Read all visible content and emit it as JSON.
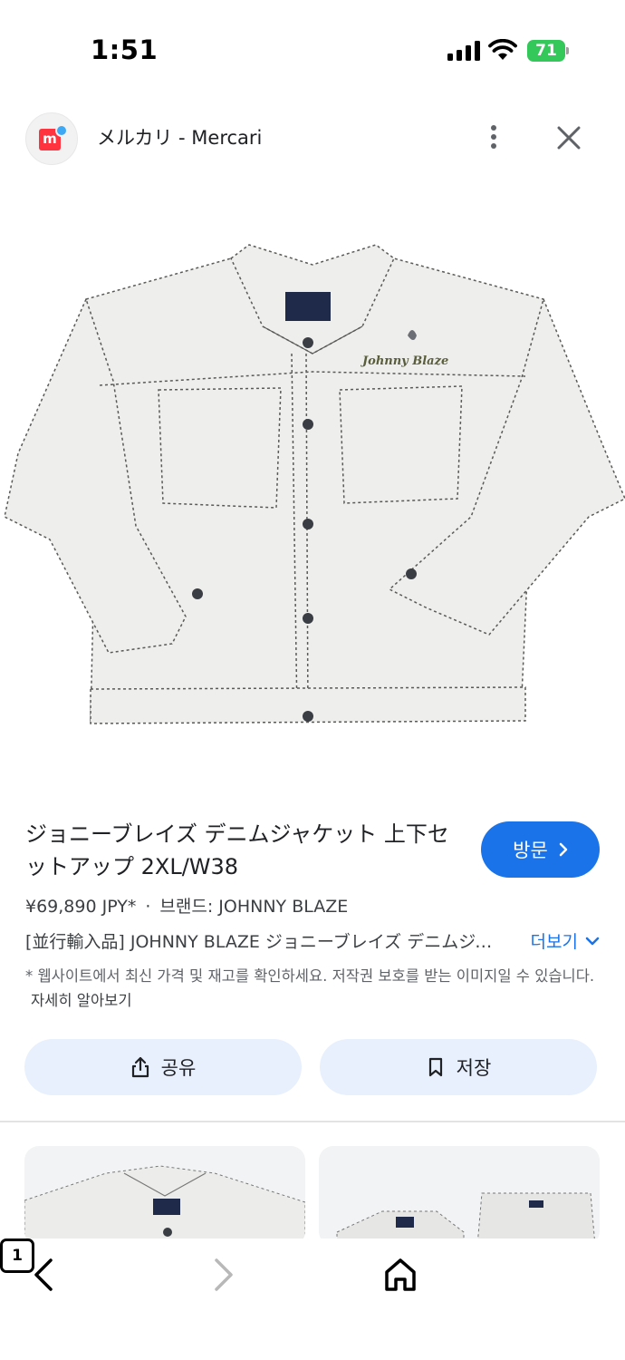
{
  "status_bar": {
    "time": "1:51",
    "battery": "71"
  },
  "source": {
    "site_name": "メルカリ - Mercari",
    "logo_letter": "m"
  },
  "product": {
    "image_alt": "Johnny Blaze white denim jacket",
    "embroidery_text": "Johnny Blaze",
    "title": "ジョニーブレイズ デニムジャケット 上下セットアップ 2XL/W38",
    "price": "¥69,890 JPY*",
    "brand": "브랜드: JOHNNY BLAZE",
    "separator": "·",
    "description": "[並行輸入品] JOHNNY BLAZE ジョニーブレイズ デニムジャケット",
    "more_label": "더보기",
    "disclaimer": "* 웹사이트에서 최신 가격 및 재고를 확인하세요. 저작권 보호를 받는 이미지일 수 있습니다.",
    "learn_more": "자세히 알아보기"
  },
  "actions": {
    "visit_label": "방문",
    "share_label": "공유",
    "save_label": "저장"
  },
  "toolbar": {
    "tab_count": "1"
  },
  "icons": [
    "signal-icon",
    "wifi-icon",
    "more-vert-icon",
    "close-icon",
    "chevron-right-icon",
    "chevron-down-icon",
    "share-icon",
    "bookmark-icon",
    "back-icon",
    "forward-icon",
    "home-icon",
    "tabs-icon"
  ],
  "colors": {
    "accent": "#1a73e8",
    "action_bg": "#e8f0fe",
    "battery": "#34c759",
    "mercari_red": "#ff333f"
  }
}
